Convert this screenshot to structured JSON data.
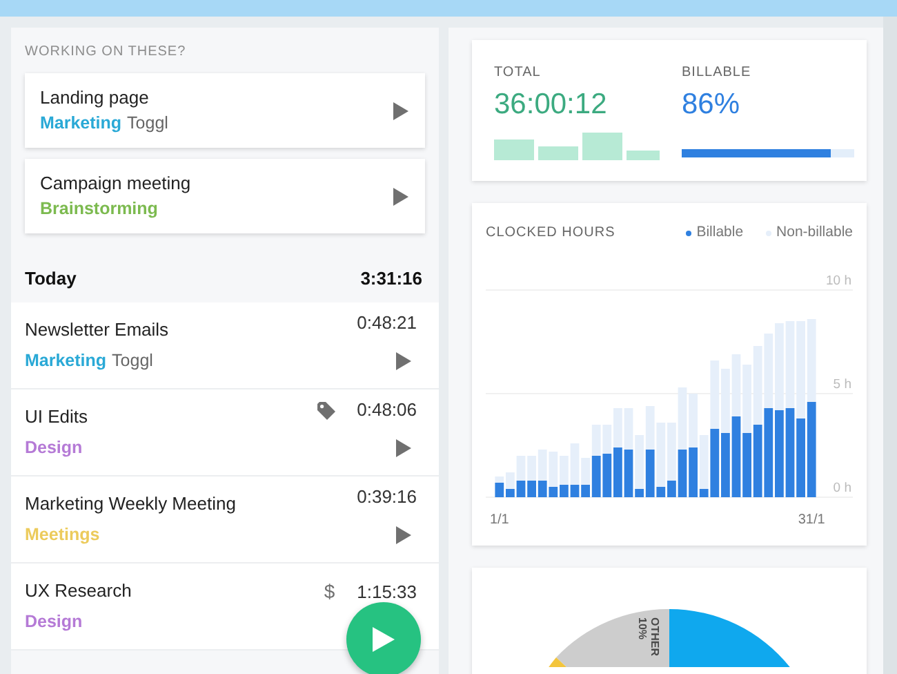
{
  "suggestions": {
    "heading": "WORKING ON THESE?",
    "items": [
      {
        "name": "Landing page",
        "project": "Marketing",
        "color": "#2aa9d6",
        "client": "Toggl"
      },
      {
        "name": "Campaign meeting",
        "project": "Brainstorming",
        "color": "#7cba4f"
      }
    ]
  },
  "today": {
    "label": "Today",
    "total": "3:31:16",
    "entries": [
      {
        "name": "Newsletter Emails",
        "project": "Marketing",
        "color": "#2aa9d6",
        "client": "Toggl",
        "duration": "0:48:21",
        "kind": "plain"
      },
      {
        "name": "UI Edits",
        "project": "Design",
        "color": "#b57ad6",
        "duration": "0:48:06",
        "kind": "tagged"
      },
      {
        "name": "Marketing Weekly Meeting",
        "project": "Meetings",
        "color": "#eccb5c",
        "duration": "0:39:16",
        "kind": "plain"
      },
      {
        "name": "UX Research",
        "project": "Design",
        "color": "#b57ad6",
        "duration": "1:15:33",
        "kind": "billable",
        "billable_mark": "$"
      }
    ]
  },
  "summary": {
    "total_label": "TOTAL",
    "total": "36:00:12",
    "billable_label": "BILLABLE",
    "billable": "86%",
    "level": 0.86
  },
  "clocked_hours": {
    "title": "CLOCKED HOURS",
    "chart_data": {
      "type": "bar",
      "stacked": true,
      "categories": [
        "1/1",
        null,
        null,
        null,
        null,
        null,
        null,
        null,
        null,
        null,
        null,
        null,
        null,
        null,
        null,
        null,
        null,
        null,
        null,
        null,
        null,
        null,
        null,
        null,
        null,
        null,
        null,
        null,
        null,
        "31/1"
      ],
      "series": [
        {
          "name": "Billable",
          "color": "#2f80e0",
          "values": [
            0.7,
            0.4,
            0.8,
            0.8,
            0.8,
            0.5,
            0.6,
            0.6,
            0.6,
            2.0,
            2.1,
            2.4,
            2.3,
            0.4,
            2.3,
            0.5,
            0.8,
            2.3,
            2.4,
            0.4,
            3.3,
            3.1,
            3.9,
            3.1,
            3.5,
            4.3,
            4.2,
            4.3,
            3.8,
            4.6
          ]
        },
        {
          "name": "Non-billable",
          "color": "#e6effa",
          "values": [
            0.3,
            0.8,
            1.2,
            1.2,
            1.5,
            1.7,
            1.4,
            2.0,
            1.3,
            1.5,
            1.4,
            1.9,
            2.0,
            2.6,
            2.1,
            3.1,
            2.8,
            3.0,
            2.6,
            2.6,
            3.3,
            3.1,
            3.0,
            3.3,
            3.8,
            3.6,
            4.2,
            4.2,
            4.7,
            4.0
          ]
        }
      ],
      "ylim": [
        0,
        10
      ],
      "yticks": [
        {
          "value": 0,
          "label": "0 h"
        },
        {
          "value": 5,
          "label": "5 h"
        },
        {
          "value": 10,
          "label": "10 h"
        }
      ]
    }
  },
  "breakdown": {
    "slice_label": "OTHER",
    "slice_value": "10%"
  }
}
